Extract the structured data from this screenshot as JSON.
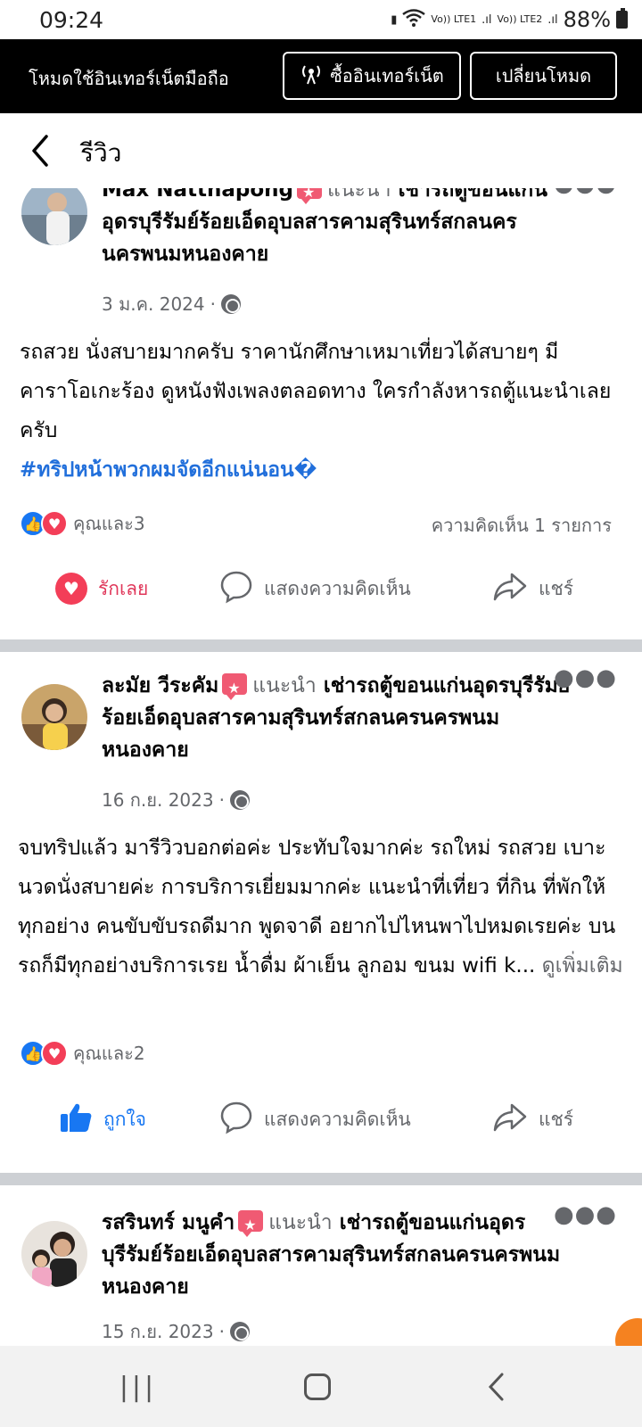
{
  "status_bar": {
    "time": "09:24",
    "network_1": "Vo)) LTE1",
    "network_2": "Vo)) LTE2",
    "battery": "88%"
  },
  "mode_bar": {
    "label": "โหมดใช้อินเทอร์เน็ตมือถือ",
    "buy_button": "ซื้ออินเทอร์เน็ต",
    "switch_button": "เปลี่ยนโหมด"
  },
  "header": {
    "title": "รีวิว"
  },
  "posts": [
    {
      "author": "Max Natthapong",
      "recommend_text": "แนะนำ",
      "page_name": "เช่ารถตู้ขอนแก่นอุดรบุรีรัมย์ร้อยเอ็ดอุบลสารคามสุรินทร์สกลนครนครพนมหนองคาย",
      "date": "3 ม.ค. 2024",
      "body": "รถสวย นั่งสบายมากครับ ราคานักศึกษาเหมาเที่ยวได้สบายๆ มีคาราโอเกะร้อง ดูหนังฟังเพลงตลอดทาง ใครกำลังหารถตู้แนะนำเลยครับ",
      "hashtag": "#ทริปหน้าพวกผมจัดอีกแน่นอน�",
      "reaction_text": "คุณและ3",
      "comment_count": "ความคิดเห็น 1 รายการ",
      "action_react": "รักเลย",
      "action_comment": "แสดงความคิดเห็น",
      "action_share": "แชร์"
    },
    {
      "author": "ละมัย วีระคัม",
      "recommend_text": "แนะนำ",
      "page_name": "เช่ารถตู้ขอนแก่นอุดรบุรีรัมย์ร้อยเอ็ดอุบลสารคามสุรินทร์สกลนครนครพนมหนองคาย",
      "date": "16 ก.ย. 2023",
      "body": "จบทริปแล้ว มารีวิวบอกต่อค่ะ ประทับใจมากค่ะ รถใหม่ รถสวย เบาะนวดนั่งสบายค่ะ การบริการเยี่ยมมากค่ะ แนะนำที่เที่ยว ที่กิน ที่พักให้ทุกอย่าง คนขับขับรถดีมาก พูดจาดี อยากไปไหนพาไปหมดเรยค่ะ บนรถก็มีทุกอย่างบริการเรย น้ำดื่ม ผ้าเย็น ลูกอม ขนม wifi k...",
      "see_more": "ดูเพิ่มเติม",
      "reaction_text": "คุณและ2",
      "action_react": "ถูกใจ",
      "action_comment": "แสดงความคิดเห็น",
      "action_share": "แชร์"
    },
    {
      "author": "รสรินทร์ มนูคำ",
      "recommend_text": "แนะนำ",
      "page_name": "เช่ารถตู้ขอนแก่นอุดรบุรีรัมย์ร้อยเอ็ดอุบลสารคามสุรินทร์สกลนครนครพนมหนองคาย",
      "date": "15 ก.ย. 2023"
    }
  ],
  "icons": {
    "back": "chevron-left-icon",
    "more": "more-horizontal-icon",
    "globe": "globe-icon",
    "like": "thumbs-up-icon",
    "love": "heart-icon",
    "comment": "comment-bubble-icon",
    "share": "share-arrow-icon"
  },
  "colors": {
    "accent_blue": "#1877f2",
    "love_red": "#f33e58",
    "hashtag_blue": "#216fdb",
    "separator": "#cdd0d4",
    "meta_gray": "#65676b"
  }
}
